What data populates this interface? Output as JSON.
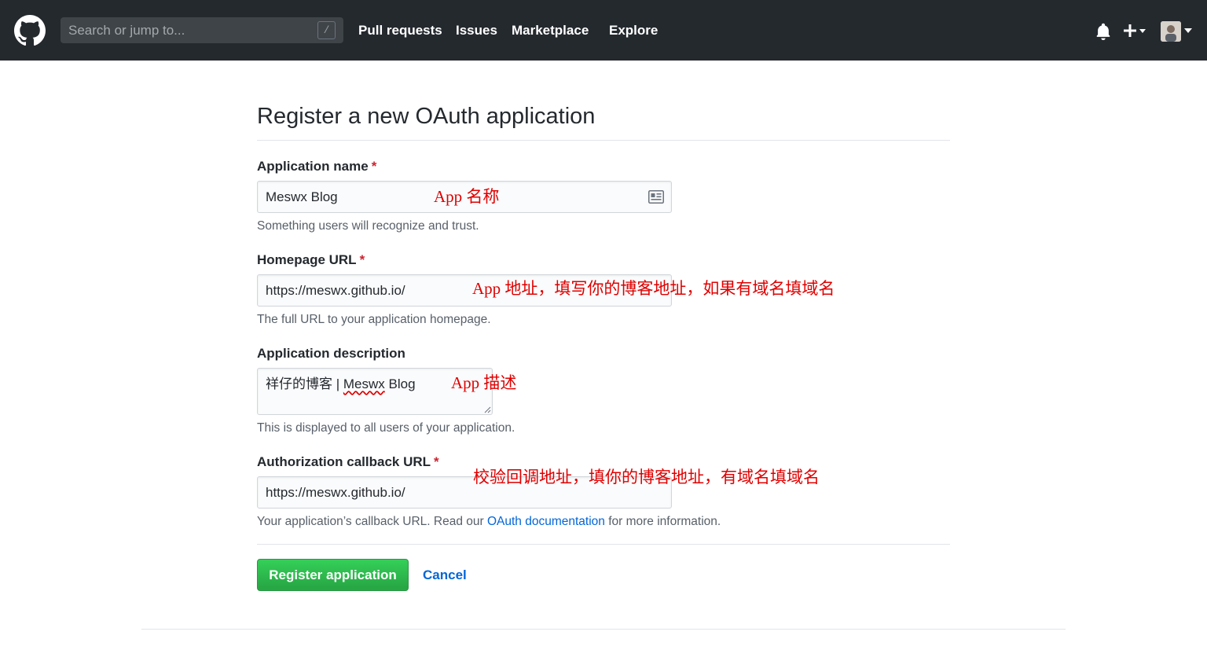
{
  "header": {
    "logo_icon": "github-octocat-icon",
    "search": {
      "placeholder": "Search or jump to...",
      "value": "",
      "shortcut": "/"
    },
    "nav": [
      {
        "label": "Pull requests"
      },
      {
        "label": "Issues"
      },
      {
        "label": "Marketplace"
      },
      {
        "label": "Explore"
      }
    ],
    "right_icons": [
      "bell-icon",
      "plus-icon",
      "caret-down-icon",
      "avatar"
    ]
  },
  "form": {
    "title": "Register a new OAuth application",
    "fields": {
      "app_name": {
        "label": "Application name",
        "required_mark": "*",
        "value": "Meswx Blog",
        "note": "Something users will recognize and trust."
      },
      "homepage": {
        "label": "Homepage URL",
        "required_mark": "*",
        "value": "https://meswx.github.io/",
        "note": "The full URL to your application homepage."
      },
      "description": {
        "label": "Application description",
        "value_prefix": "祥仔的博客 | ",
        "value_misspelled": "Meswx",
        "value_suffix": " Blog",
        "note": "This is displayed to all users of your application."
      },
      "callback": {
        "label": "Authorization callback URL",
        "required_mark": "*",
        "value": "https://meswx.github.io/",
        "note_prefix": "Your application’s callback URL. Read our ",
        "note_link": "OAuth documentation",
        "note_suffix": " for more information."
      }
    },
    "buttons": {
      "submit": "Register application",
      "cancel": "Cancel"
    }
  },
  "annotations": {
    "app_name": "App 名称",
    "homepage": "App 地址，填写你的博客地址，如果有域名填域名",
    "description": "App 描述",
    "callback": "校验回调地址，填你的博客地址，有域名填域名"
  },
  "colors": {
    "header_bg": "#24292e",
    "primary_button": "#28a745",
    "link": "#0366d6",
    "required": "#cb2431",
    "annotation": "#e00000"
  }
}
